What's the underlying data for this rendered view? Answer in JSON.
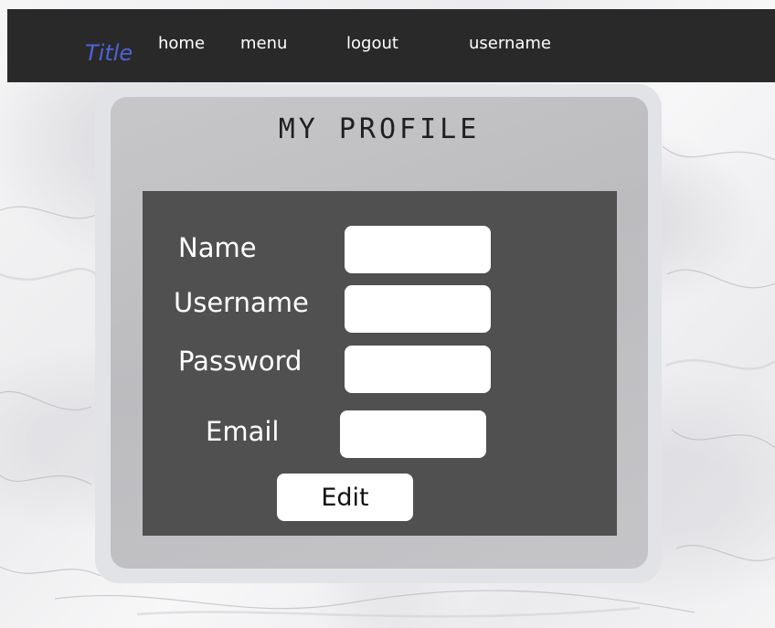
{
  "navbar": {
    "title": "Title",
    "links": {
      "home": "home",
      "menu": "menu",
      "logout": "logout",
      "username": "username"
    }
  },
  "profile": {
    "heading": "MY PROFILE",
    "fields": {
      "name": {
        "label": "Name",
        "value": ""
      },
      "username": {
        "label": "Username",
        "value": ""
      },
      "password": {
        "label": "Password",
        "value": ""
      },
      "email": {
        "label": "Email",
        "value": ""
      }
    },
    "edit_label": "Edit"
  },
  "colors": {
    "navbar_bg": "#2a2929",
    "title_accent": "#4d63d6",
    "card_outer": "#e1e3e6",
    "card_inner": "#c2c2c4",
    "form_panel": "#505050"
  }
}
